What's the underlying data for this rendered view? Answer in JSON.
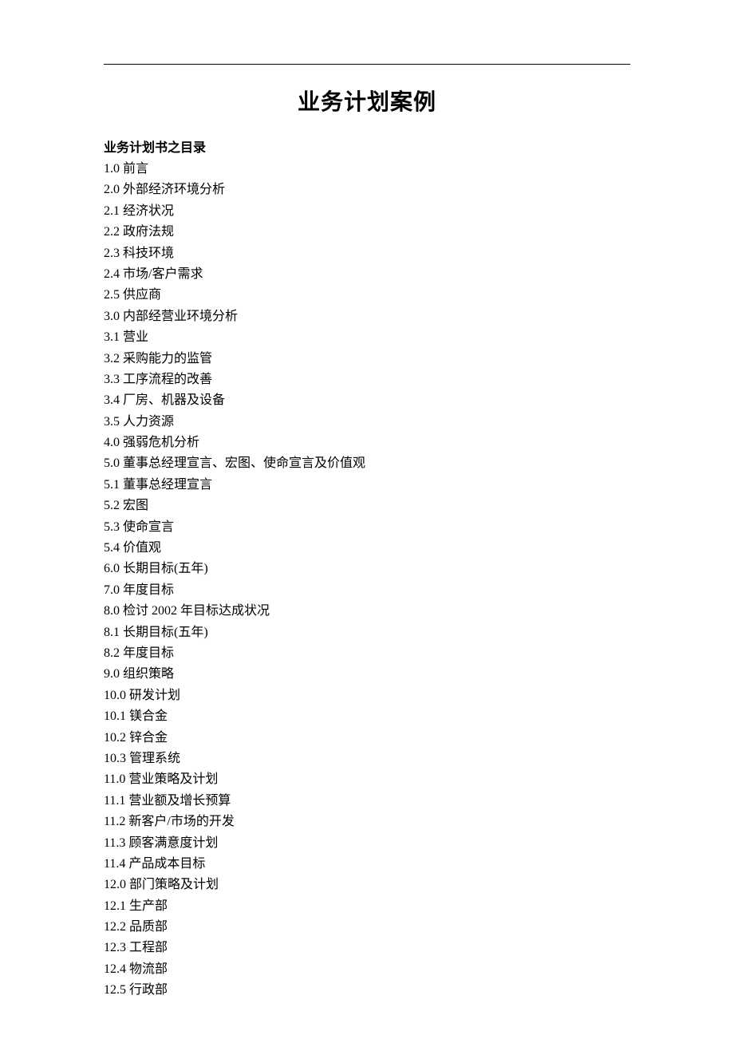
{
  "title": "业务计划案例",
  "subtitle": "业务计划书之目录",
  "toc": [
    "1.0 前言",
    "2.0 外部经济环境分析",
    "2.1 经济状况",
    "2.2 政府法规",
    "2.3 科技环境",
    "2.4 市场/客户需求",
    "2.5 供应商",
    "3.0 内部经营业环境分析",
    "3.1 营业",
    "3.2 采购能力的监管",
    "3.3 工序流程的改善",
    "3.4 厂房、机器及设备",
    "3.5 人力资源",
    "4.0 强弱危机分析",
    "5.0 董事总经理宣言、宏图、使命宣言及价值观",
    "5.1 董事总经理宣言",
    "5.2 宏图",
    "5.3 使命宣言",
    "5.4 价值观",
    "6.0 长期目标(五年)",
    "7.0 年度目标",
    "8.0 检讨 2002 年目标达成状况",
    "8.1 长期目标(五年)",
    "8.2 年度目标",
    "9.0 组织策略",
    "10.0 研发计划",
    "10.1 镁合金",
    "10.2 锌合金",
    "10.3 管理系统",
    "11.0 营业策略及计划",
    "11.1 营业额及增长预算",
    "11.2 新客户/市场的开发",
    "11.3 顾客满意度计划",
    "11.4 产品成本目标",
    "12.0 部门策略及计划",
    "12.1 生产部",
    "12.2 品质部",
    "12.3 工程部",
    "12.4 物流部",
    "12.5 行政部"
  ]
}
